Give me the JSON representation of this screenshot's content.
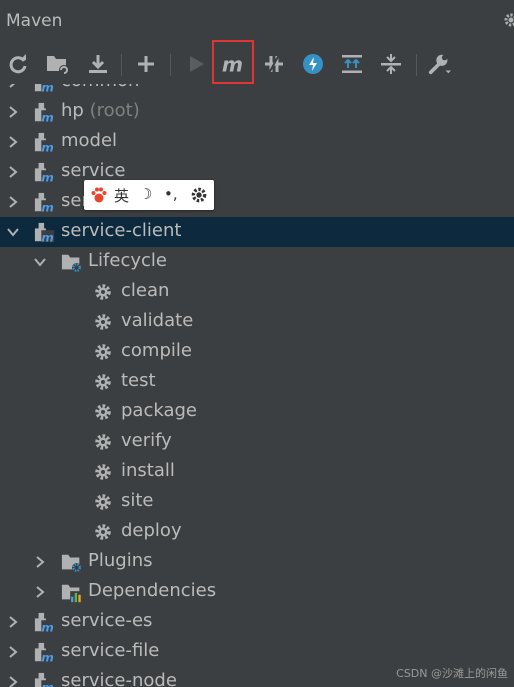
{
  "window": {
    "title": "Maven"
  },
  "toolbar": {
    "buttons": [
      {
        "name": "reload-icon"
      },
      {
        "name": "add-folder-icon"
      },
      {
        "name": "download-icon"
      },
      {
        "name": "plus-icon"
      },
      {
        "name": "run-icon"
      },
      {
        "name": "maven-goal-icon"
      },
      {
        "name": "toggle-offline-icon"
      },
      {
        "name": "lightning-icon"
      },
      {
        "name": "expand-all-icon"
      },
      {
        "name": "collapse-all-icon"
      },
      {
        "name": "wrench-icon"
      }
    ]
  },
  "tree": {
    "items": [
      {
        "label": "common"
      },
      {
        "label": "hp",
        "suffix": "(root)"
      },
      {
        "label": "model"
      },
      {
        "label": "service"
      },
      {
        "label": "service-beans"
      },
      {
        "label": "service-client"
      },
      {
        "label": "Lifecycle"
      },
      {
        "label": "clean"
      },
      {
        "label": "validate"
      },
      {
        "label": "compile"
      },
      {
        "label": "test"
      },
      {
        "label": "package"
      },
      {
        "label": "verify"
      },
      {
        "label": "install"
      },
      {
        "label": "site"
      },
      {
        "label": "deploy"
      },
      {
        "label": "Plugins"
      },
      {
        "label": "Dependencies"
      },
      {
        "label": "service-es"
      },
      {
        "label": "service-file"
      },
      {
        "label": "service-node"
      }
    ]
  },
  "ime_toolbar": {
    "lang": "英",
    "moon": "☽",
    "punct": "•,"
  },
  "watermark": "CSDN @沙滩上的闲鱼",
  "colors": {
    "background": "#3c3f41",
    "selection": "#0d293e",
    "highlight": "#e03535",
    "maven_icon": "#4e9ce8"
  }
}
